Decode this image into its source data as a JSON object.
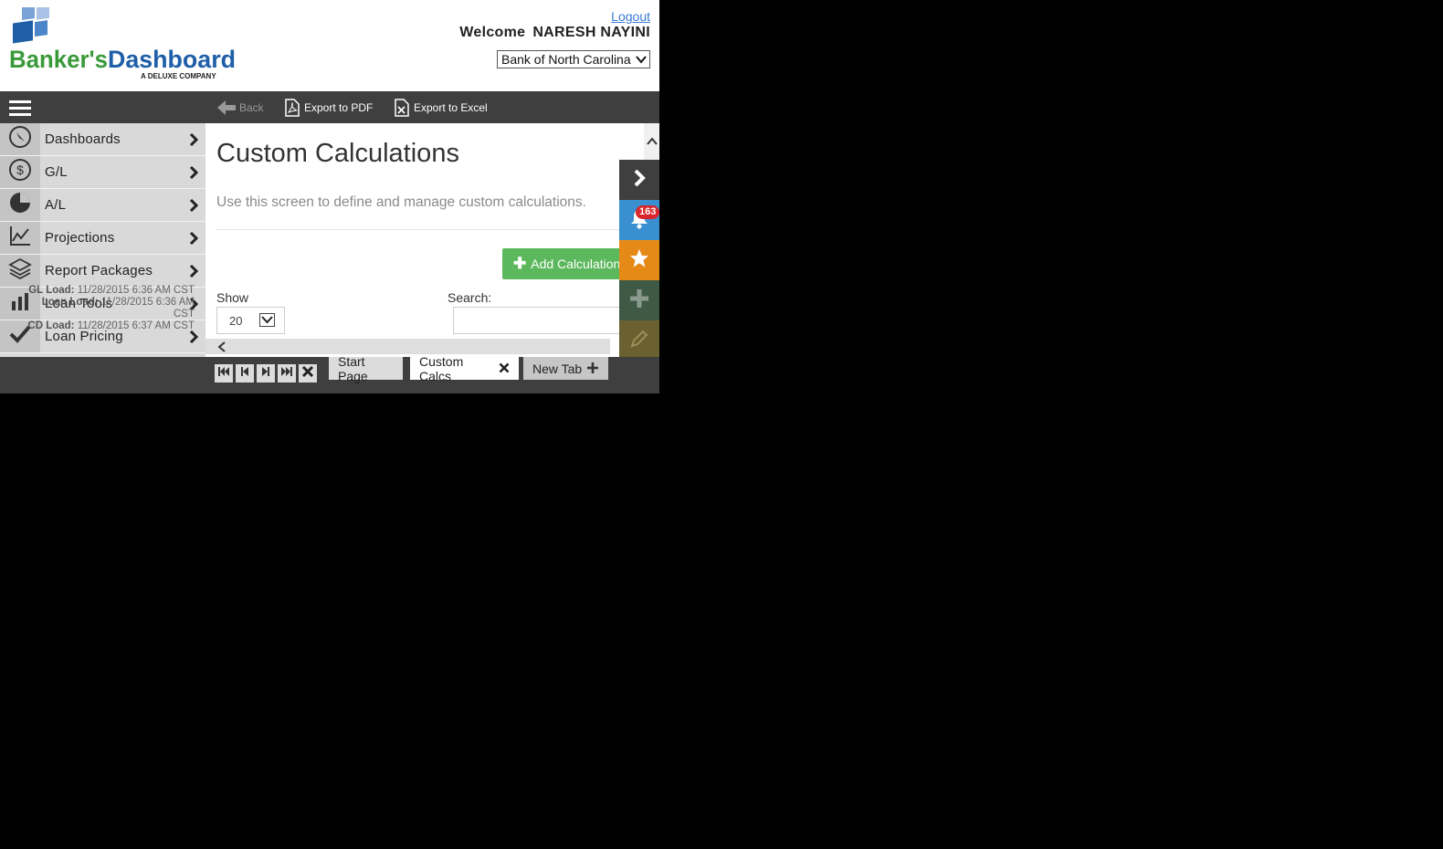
{
  "header": {
    "brand_name": "Banker'sDashboard",
    "brand_tagline": "A DELUXE COMPANY",
    "logout_label": "Logout",
    "welcome_label": "Welcome",
    "user_name": "NARESH NAYINI",
    "bank_selected": "Bank of North Carolina"
  },
  "toolbar": {
    "back_label": "Back",
    "export_pdf_label": "Export to PDF",
    "export_excel_label": "Export to Excel"
  },
  "sidebar": {
    "items": [
      {
        "label": "Dashboards",
        "icon": "compass-icon"
      },
      {
        "label": "G/L",
        "icon": "dollar-circle-icon"
      },
      {
        "label": "A/L",
        "icon": "pie-chart-icon"
      },
      {
        "label": "Projections",
        "icon": "line-chart-icon"
      },
      {
        "label": "Report Packages",
        "icon": "layers-icon"
      },
      {
        "label": "Loan Tools",
        "icon": "bar-chart-icon"
      },
      {
        "label": "Loan Pricing",
        "icon": "check-icon"
      }
    ],
    "loads": {
      "gl_label": "GL Load:",
      "gl_value": "11/28/2015 6:36 AM CST",
      "loan_label": "Loan Load:",
      "loan_value": "11/28/2015 6:36 AM",
      "loan_tz": "CST",
      "cd_label": "CD Load:",
      "cd_value": "11/28/2015 6:37 AM CST"
    }
  },
  "main": {
    "title": "Custom Calculations",
    "description": "Use this screen to define and manage custom calculations.",
    "add_button_label": "Add Calculation",
    "show_label": "Show",
    "show_value": "20",
    "search_label": "Search:",
    "search_value": ""
  },
  "right_panel": {
    "notification_count": "163",
    "colors": {
      "toggle": "#3f3f3f",
      "notify": "#3a8fd0",
      "favorite": "#e58a17",
      "add": "#3e5a45",
      "edit": "#6a6030"
    }
  },
  "tabs": [
    {
      "label": "Start Page"
    },
    {
      "label": "Custom Calcs"
    },
    {
      "label": "New Tab"
    }
  ],
  "colors": {
    "accent_green": "#5cb85c",
    "toolbar_bg": "#3f3f3f",
    "brand_blue": "#1f5fa8",
    "brand_green": "#3a9a3a"
  }
}
